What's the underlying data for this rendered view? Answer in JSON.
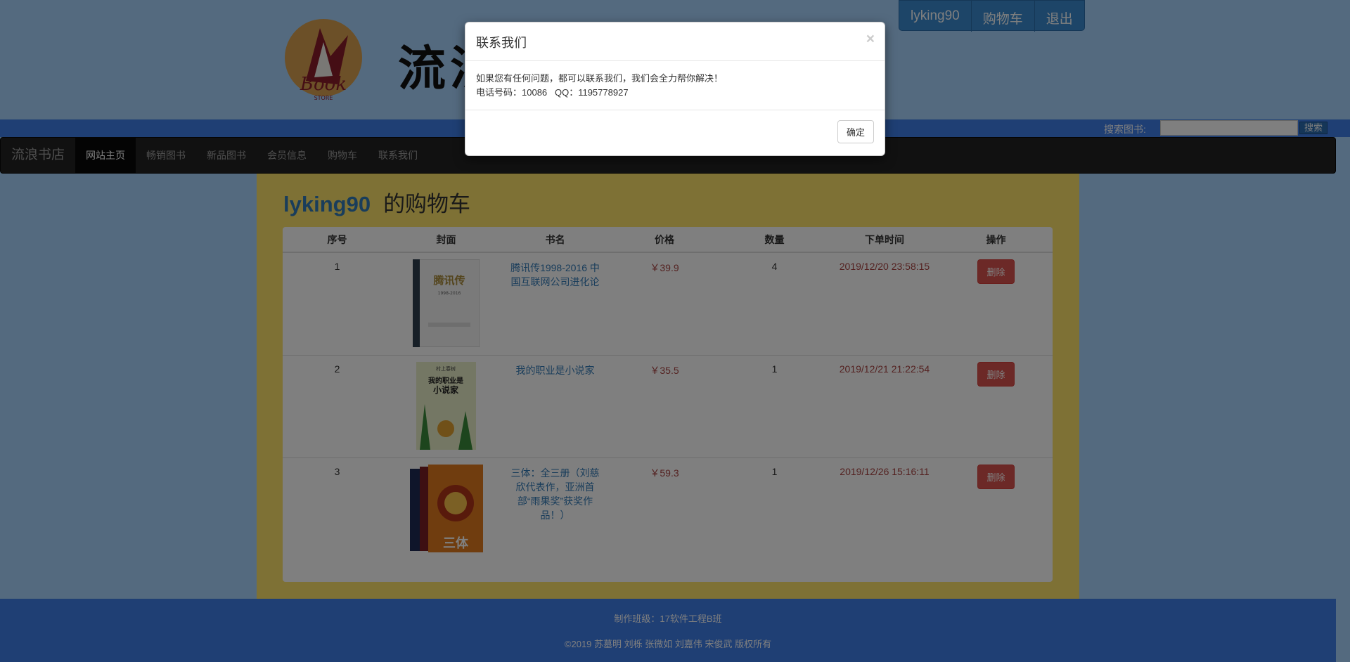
{
  "header": {
    "brand_text": "流浪书店",
    "logo_text": "BOOK STORE",
    "user_menu": [
      "lyking90",
      "购物车",
      "退出"
    ]
  },
  "search": {
    "label": "搜索图书:",
    "button": "搜索",
    "placeholder": ""
  },
  "navbar": {
    "brand": "流浪书店",
    "items": [
      "网站主页",
      "畅销图书",
      "新品图书",
      "会员信息",
      "购物车",
      "联系我们"
    ],
    "active": "网站主页"
  },
  "cart": {
    "user": "lyking90",
    "title_suffix": "的购物车",
    "columns": [
      "序号",
      "封面",
      "书名",
      "价格",
      "数量",
      "下单时间",
      "操作"
    ],
    "rows": [
      {
        "no": "1",
        "title": "腾讯传1998-2016 中国互联网公司进化论",
        "price": "￥39.9",
        "qty": "4",
        "time": "2019/12/20 23:58:15",
        "action": "删除"
      },
      {
        "no": "2",
        "title": "我的职业是小说家",
        "price": "￥35.5",
        "qty": "1",
        "time": "2019/12/21 21:22:54",
        "action": "删除"
      },
      {
        "no": "3",
        "title": "三体：全三册（刘慈欣代表作，亚洲首部“雨果奖”获奖作品！）",
        "price": "￥59.3",
        "qty": "1",
        "time": "2019/12/26 15:16:11",
        "action": "删除"
      }
    ]
  },
  "covers": [
    {
      "title": "腾讯传",
      "subtitle": "1998-2016",
      "color": "#f4f4f4"
    },
    {
      "title": "我的职业是小说家",
      "author": "村上春树",
      "color": "#e8eec8"
    },
    {
      "title": "三体",
      "color": "#e07a1e"
    }
  ],
  "footer": {
    "class_line": "制作班级：17软件工程B班",
    "copyright": "©2019 苏墓明 刘栎 张微如 刘嘉伟 宋俊武 版权所有"
  },
  "modal": {
    "title": "联系我们",
    "close": "×",
    "line1": "如果您有任何问题，都可以联系我们，我们会全力帮你解决！",
    "line2": "电话号码：10086   QQ：1195778927",
    "ok": "确定"
  }
}
